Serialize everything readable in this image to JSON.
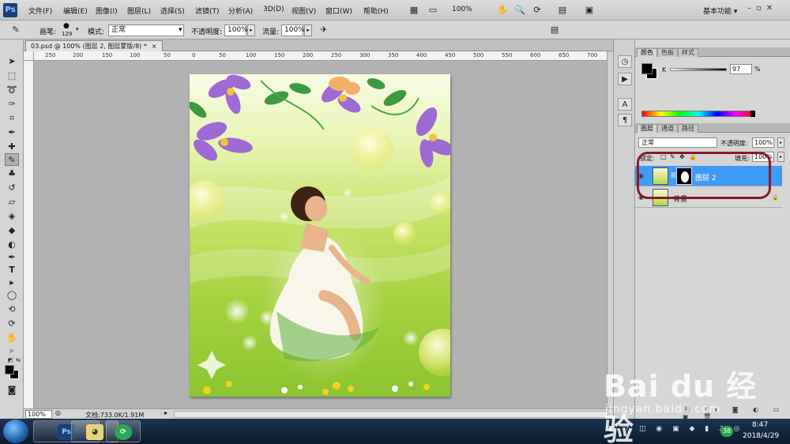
{
  "menubar": {
    "logo": "Ps",
    "items": [
      "文件(F)",
      "编辑(E)",
      "图像(I)",
      "图层(L)",
      "选择(S)",
      "滤镜(T)",
      "分析(A)",
      "3D(D)",
      "视图(V)",
      "窗口(W)",
      "帮助(H)"
    ],
    "zoom": "100%",
    "workspace": "基本功能 ▾",
    "window_controls": "–▫✕"
  },
  "options": {
    "brush_label": "画笔:",
    "brush_size": "129",
    "mode_label": "模式:",
    "mode_value": "正常",
    "opacity_label": "不透明度:",
    "opacity_value": "100%",
    "flow_label": "流量:",
    "flow_value": "100%"
  },
  "document": {
    "tab_title": "03.psd @ 100% (图层 2, 图层蒙版/8) *",
    "tab_close": "×",
    "ruler_labels": [
      "250",
      "200",
      "150",
      "100",
      "50",
      "0",
      "50",
      "100",
      "150",
      "200",
      "250",
      "300",
      "350",
      "400",
      "450",
      "500",
      "550",
      "600",
      "650",
      "700"
    ],
    "status_zoom": "100%",
    "status_doc": "文档:733.0K/1.91M"
  },
  "panels": {
    "color_tabs": [
      "颜色",
      "色板",
      "样式"
    ],
    "k_label": "K",
    "k_value": "97",
    "k_unit": "%",
    "layers_tabs": [
      "图层",
      "通道",
      "路径"
    ],
    "blend_mode": "正常",
    "opacity_label": "不透明度:",
    "opacity_value": "100%",
    "lock_label": "锁定:",
    "fill_label": "填充:",
    "fill_value": "100%",
    "layers": [
      {
        "name": "图层 2",
        "selected": true
      },
      {
        "name": "背景",
        "selected": false
      }
    ]
  },
  "taskbar": {
    "ps_label": "Ps",
    "badge": "38",
    "time": "8:47",
    "date": "2018/4/29"
  },
  "watermark": {
    "brand": "Bai du 经验",
    "url": "jingyan.baidu.com"
  },
  "colors": {
    "accent_selected": "#3f9bf5",
    "highlight_ring": "#8a1a2a"
  }
}
